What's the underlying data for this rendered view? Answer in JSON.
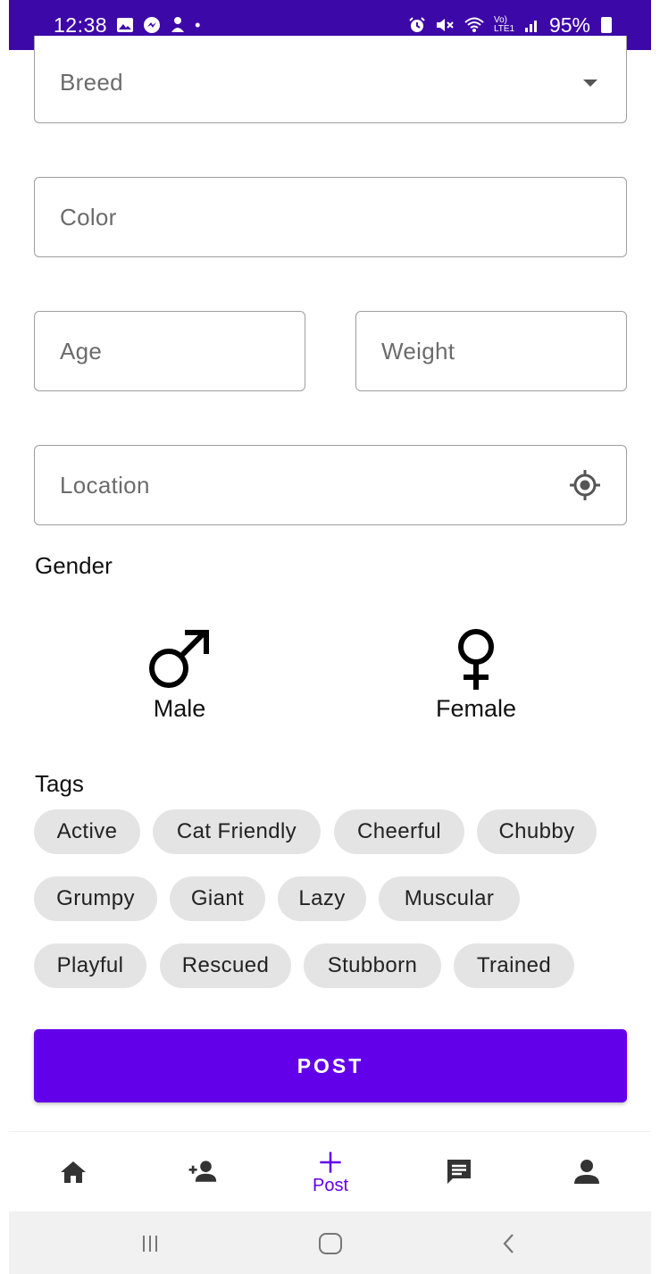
{
  "status_bar": {
    "time": "12:38",
    "battery": "95%",
    "left_icons": [
      "gallery-icon",
      "messenger-icon",
      "app-icon",
      "dot-icon"
    ],
    "right_icons": [
      "alarm-icon",
      "mute-icon",
      "wifi-icon",
      "volte-icon",
      "signal-icon",
      "battery-icon"
    ],
    "volte_label": "Vo) LTE1",
    "background": "#3d08a8"
  },
  "form": {
    "breed_label": "Breed",
    "color_label": "Color",
    "age_label": "Age",
    "weight_label": "Weight",
    "location_label": "Location"
  },
  "gender": {
    "label": "Gender",
    "male_label": "Male",
    "female_label": "Female"
  },
  "tags": {
    "label": "Tags",
    "items": [
      "Active",
      "Cat Friendly",
      "Cheerful",
      "Chubby",
      "Grumpy",
      "Giant",
      "Lazy",
      "Muscular",
      "Playful",
      "Rescued",
      "Stubborn",
      "Trained"
    ],
    "chip_color": "#e4e4e4"
  },
  "post_button": {
    "label": "POST",
    "color": "#6200ea"
  },
  "bottom_nav": {
    "items": [
      {
        "icon": "home-icon",
        "label": ""
      },
      {
        "icon": "add-person-icon",
        "label": ""
      },
      {
        "icon": "plus-icon",
        "label": "Post"
      },
      {
        "icon": "chat-icon",
        "label": ""
      },
      {
        "icon": "person-icon",
        "label": ""
      }
    ],
    "active_color": "#6200ea"
  },
  "system_nav": {
    "icons": [
      "recent-apps-icon",
      "home-button-icon",
      "back-icon"
    ]
  }
}
